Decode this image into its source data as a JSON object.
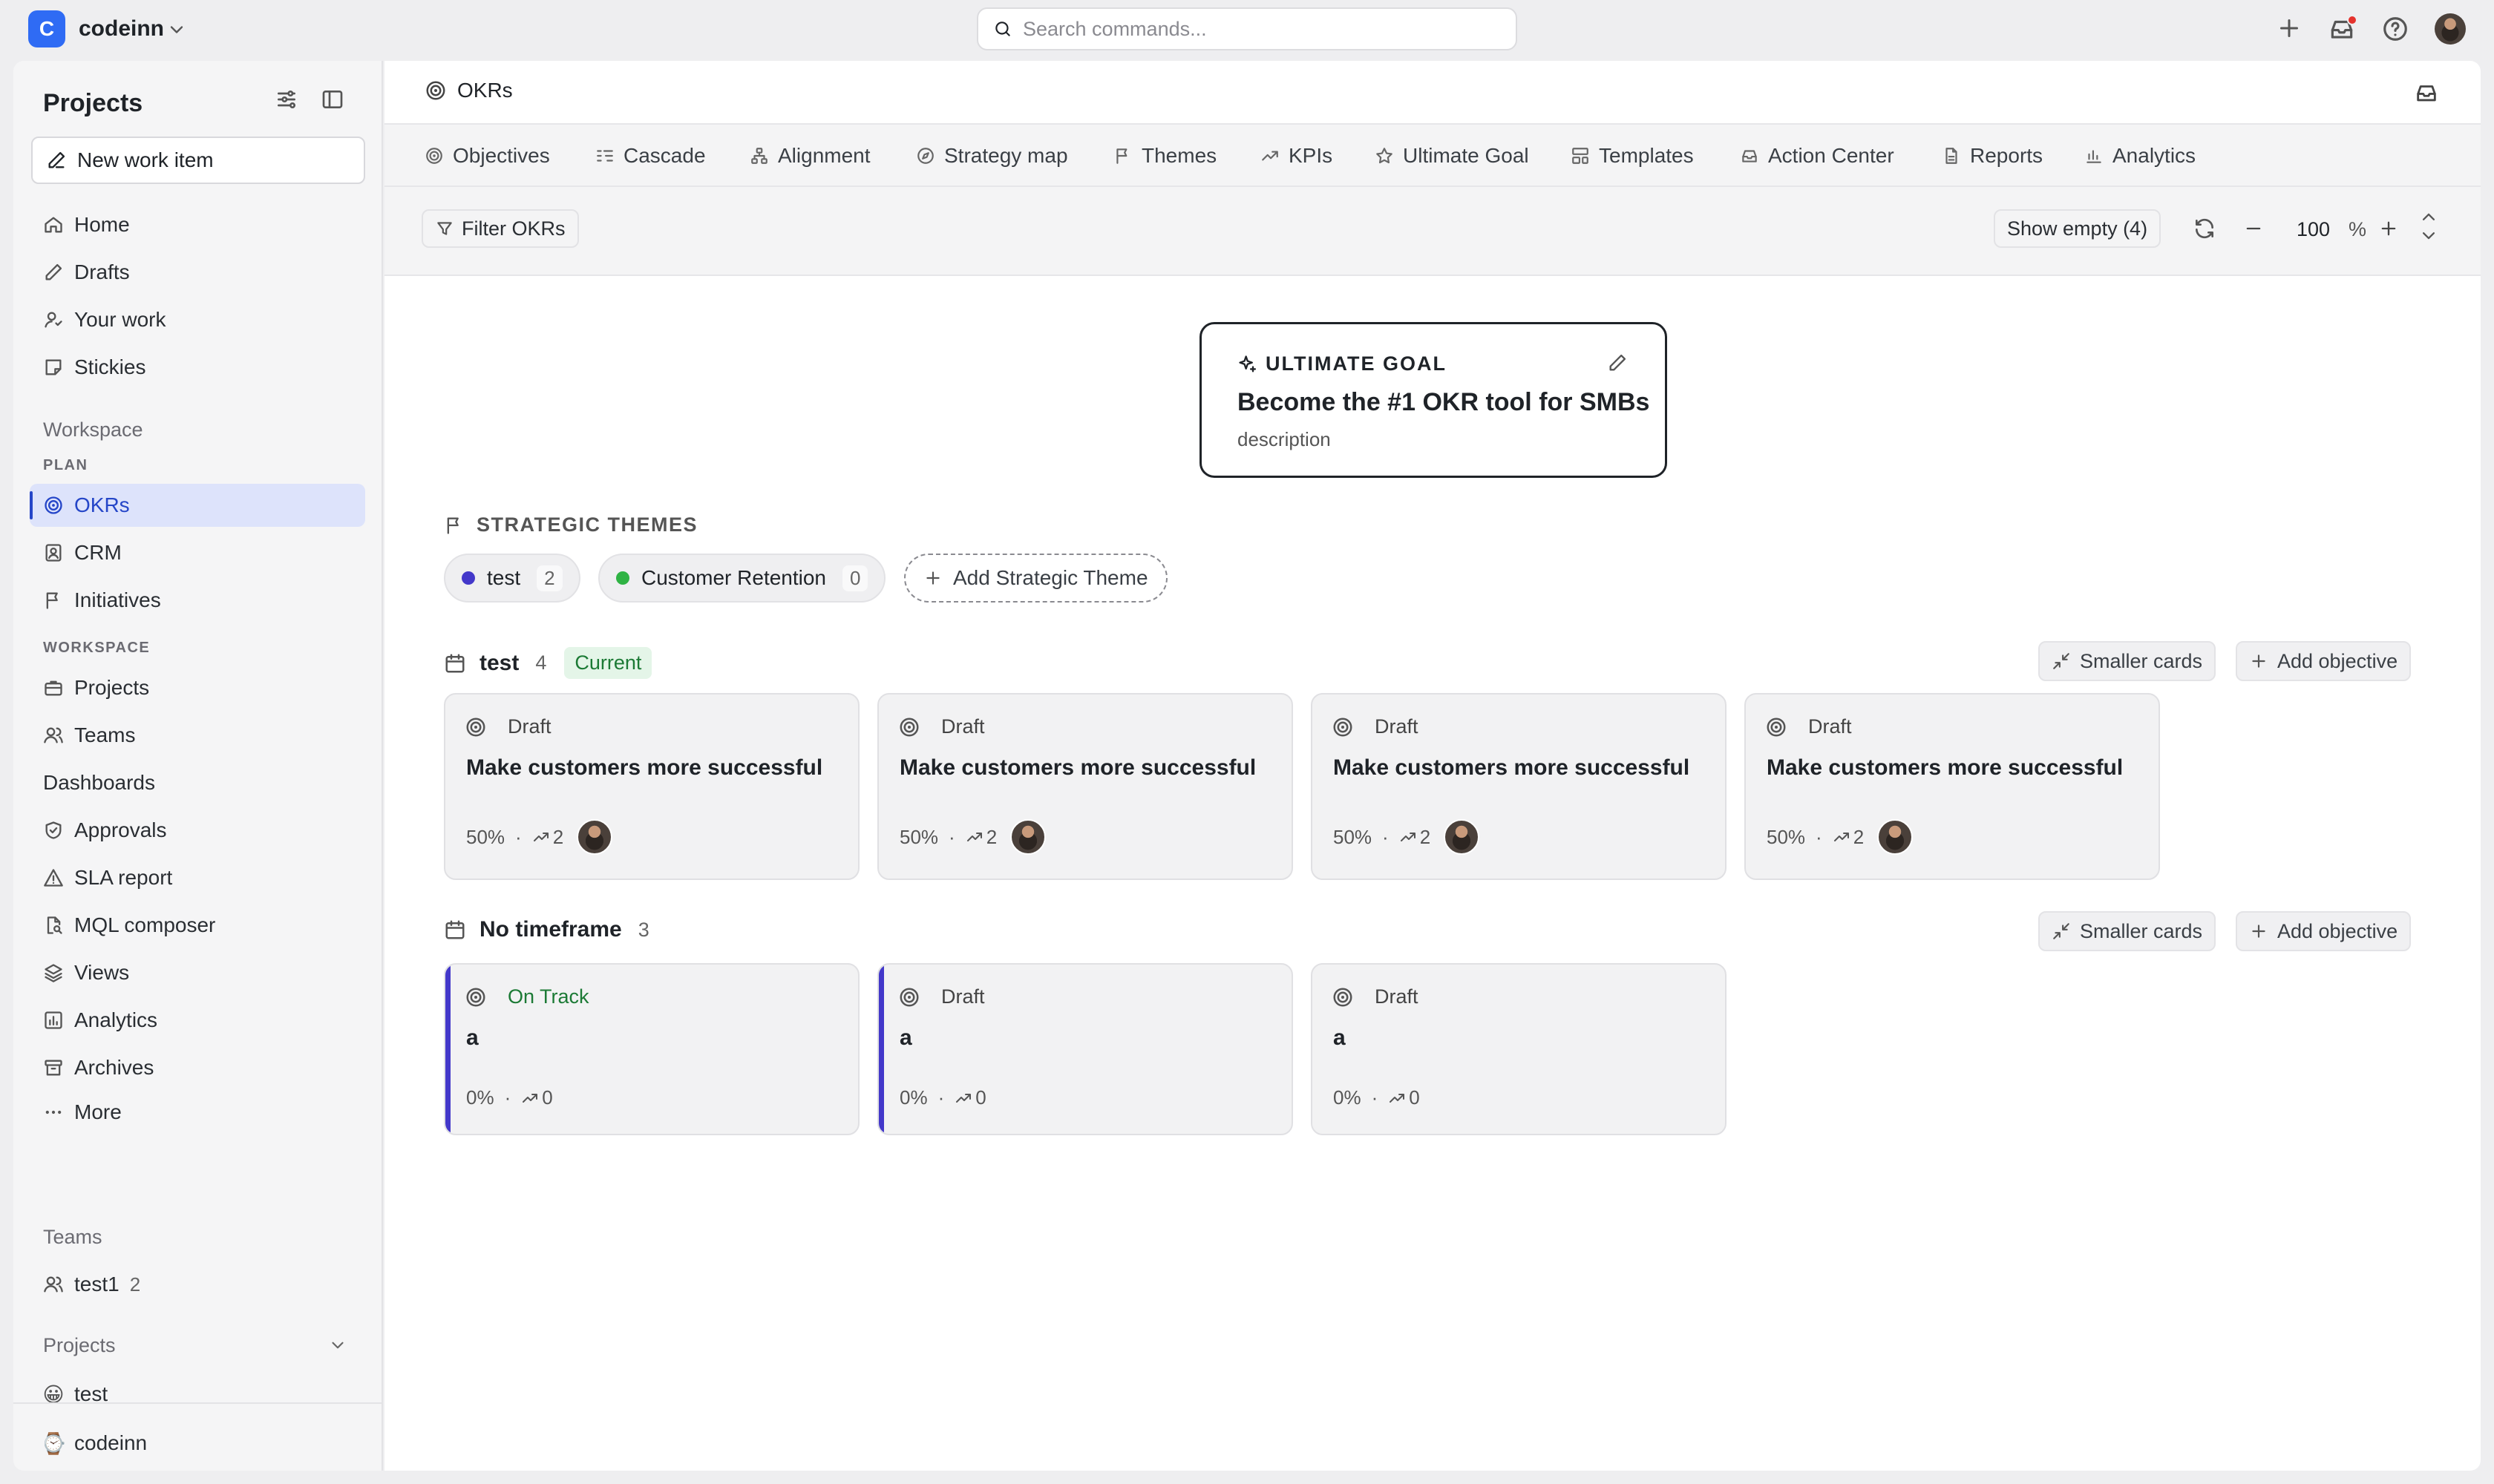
{
  "workspace": {
    "initial": "C",
    "name": "codeinn"
  },
  "search": {
    "placeholder": "Search commands..."
  },
  "sidebar": {
    "title": "Projects",
    "new_item": "New work item",
    "main_items": [
      "Home",
      "Drafts",
      "Your work",
      "Stickies"
    ],
    "workspace_label": "Workspace",
    "plan_label": "PLAN",
    "plan_items": [
      "OKRs",
      "CRM",
      "Initiatives"
    ],
    "workspace_cap": "WORKSPACE",
    "workspace_items": [
      "Projects",
      "Teams",
      "Dashboards",
      "Approvals",
      "SLA report",
      "MQL composer",
      "Views",
      "Analytics",
      "Archives",
      "More"
    ],
    "teams_label": "Teams",
    "team": {
      "name": "test1",
      "count": "2"
    },
    "projects_label": "Projects",
    "projects": [
      {
        "emoji": "😀",
        "name": "test"
      },
      {
        "emoji": "⌚",
        "name": "codeinn"
      }
    ]
  },
  "header": {
    "title": "OKRs"
  },
  "tabs": [
    "Objectives",
    "Cascade",
    "Alignment",
    "Strategy map",
    "Themes",
    "KPIs",
    "Ultimate Goal",
    "Templates",
    "Action Center",
    "Reports",
    "Analytics"
  ],
  "toolbar": {
    "filter": "Filter OKRs",
    "show_empty": "Show empty (4)",
    "zoom_value": "100",
    "zoom_unit": "%"
  },
  "ultimate_goal": {
    "label": "ULTIMATE GOAL",
    "title": "Become the #1 OKR tool for SMBs",
    "description": "description"
  },
  "themes": {
    "heading": "STRATEGIC THEMES",
    "items": [
      {
        "name": "test",
        "count": "2",
        "color": "#4338ca"
      },
      {
        "name": "Customer Retention",
        "count": "0",
        "color": "#2fb344"
      }
    ],
    "add_label": "Add Strategic Theme"
  },
  "groups": [
    {
      "name": "test",
      "count": "4",
      "badge": "Current",
      "smaller_cards": "Smaller cards",
      "add_objective": "Add objective",
      "cards": [
        {
          "status": "Draft",
          "title": "Make customers more successful",
          "progress": "50%",
          "krs": "2"
        },
        {
          "status": "Draft",
          "title": "Make customers more successful",
          "progress": "50%",
          "krs": "2"
        },
        {
          "status": "Draft",
          "title": "Make customers more successful",
          "progress": "50%",
          "krs": "2"
        },
        {
          "status": "Draft",
          "title": "Make customers more successful",
          "progress": "50%",
          "krs": "2"
        }
      ]
    },
    {
      "name": "No timeframe",
      "count": "3",
      "smaller_cards": "Smaller cards",
      "add_objective": "Add objective",
      "cards": [
        {
          "status": "On Track",
          "title": "a",
          "progress": "0%",
          "krs": "0"
        },
        {
          "status": "Draft",
          "title": "a",
          "progress": "0%",
          "krs": "0"
        },
        {
          "status": "Draft",
          "title": "a",
          "progress": "0%",
          "krs": "0"
        }
      ]
    }
  ],
  "colors": {
    "accent": "#2546c8",
    "theme_accent": "#4338ca",
    "ontrack": "#1c7a35",
    "notification": "#e5322d"
  }
}
